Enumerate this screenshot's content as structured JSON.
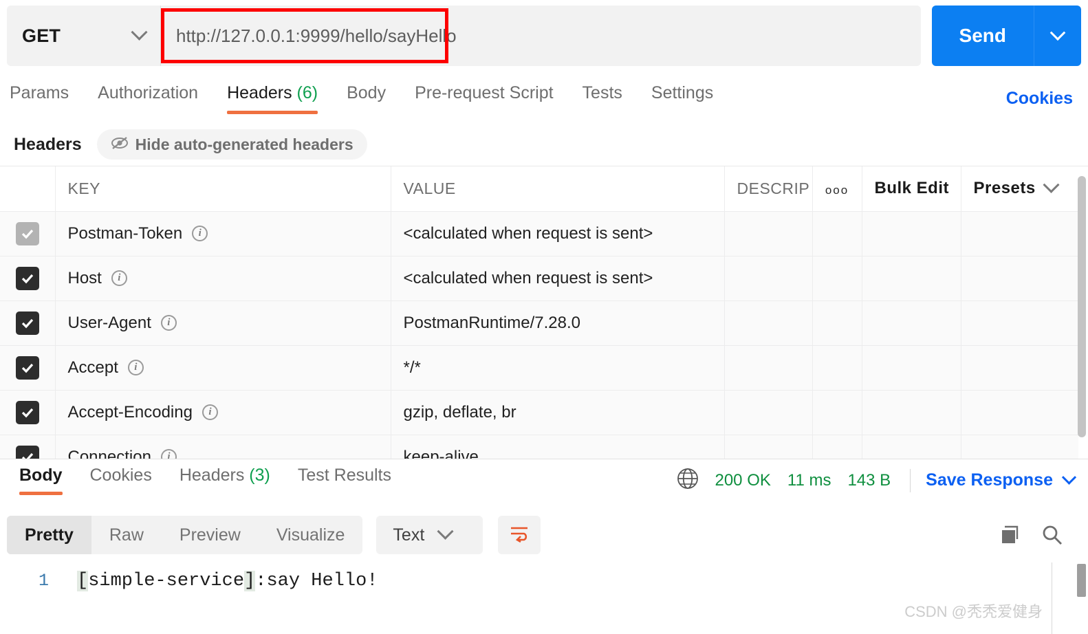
{
  "request": {
    "method": "GET",
    "url": "http://127.0.0.1:9999/hello/sayHello",
    "send_label": "Send",
    "accent_blue": "#0c7ff2",
    "annotation_color": "#fd0000"
  },
  "request_tabs": [
    {
      "label": "Params",
      "count": "",
      "active": false
    },
    {
      "label": "Authorization",
      "count": "",
      "active": false
    },
    {
      "label": "Headers",
      "count": "(6)",
      "active": true
    },
    {
      "label": "Body",
      "count": "",
      "active": false
    },
    {
      "label": "Pre-request Script",
      "count": "",
      "active": false
    },
    {
      "label": "Tests",
      "count": "",
      "active": false
    },
    {
      "label": "Settings",
      "count": "",
      "active": false
    }
  ],
  "cookies_link": "Cookies",
  "headers_section": {
    "title": "Headers",
    "hide_toggle": "Hide auto-generated headers",
    "hide_toggle_icon": "eye-slash-icon",
    "columns": {
      "key": "KEY",
      "value": "VALUE",
      "description": "DESCRIP",
      "more": "ooo",
      "bulk_edit": "Bulk Edit",
      "presets": "Presets"
    },
    "rows": [
      {
        "checked": true,
        "dim": true,
        "key": "Postman-Token",
        "value": "<calculated when request is sent>",
        "description": ""
      },
      {
        "checked": true,
        "dim": false,
        "key": "Host",
        "value": "<calculated when request is sent>",
        "description": ""
      },
      {
        "checked": true,
        "dim": false,
        "key": "User-Agent",
        "value": "PostmanRuntime/7.28.0",
        "description": ""
      },
      {
        "checked": true,
        "dim": false,
        "key": "Accept",
        "value": "*/*",
        "description": ""
      },
      {
        "checked": true,
        "dim": false,
        "key": "Accept-Encoding",
        "value": "gzip, deflate, br",
        "description": ""
      },
      {
        "checked": true,
        "dim": false,
        "key": "Connection",
        "value": "keep-alive",
        "description": ""
      }
    ]
  },
  "response": {
    "tabs": [
      {
        "label": "Body",
        "count": "",
        "active": true
      },
      {
        "label": "Cookies",
        "count": "",
        "active": false
      },
      {
        "label": "Headers",
        "count": "(3)",
        "active": false
      },
      {
        "label": "Test Results",
        "count": "",
        "active": false
      }
    ],
    "status": "200 OK",
    "time": "11 ms",
    "size": "143 B",
    "save_label": "Save Response",
    "status_color": "#0f8f3f",
    "globe_icon": "globe-icon",
    "view_modes": [
      {
        "label": "Pretty",
        "active": true
      },
      {
        "label": "Raw",
        "active": false
      },
      {
        "label": "Preview",
        "active": false
      },
      {
        "label": "Visualize",
        "active": false
      }
    ],
    "format": "Text",
    "wrap_icon": "word-wrap-icon",
    "copy_icon": "copy-icon",
    "search_icon": "search-icon",
    "body_line_number": "1",
    "body_bracket_open": "[",
    "body_bracket_name": "simple-service",
    "body_bracket_close": "]",
    "body_rest": ":say Hello!"
  },
  "watermark": "CSDN @秃秃爱健身"
}
